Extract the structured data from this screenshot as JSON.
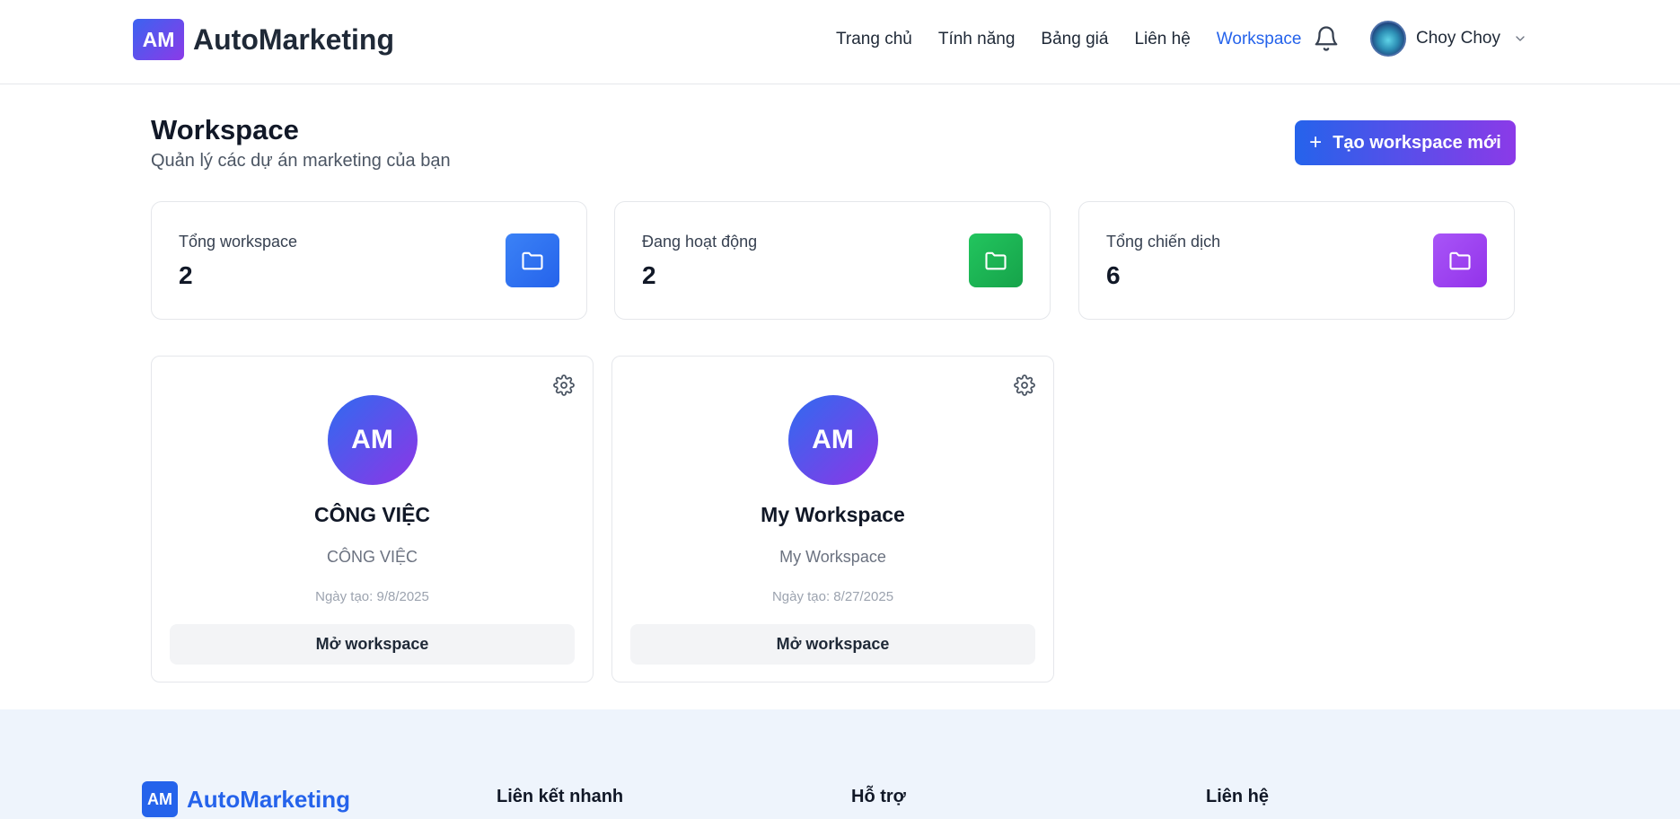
{
  "header": {
    "logo_text": "AM",
    "brand": "AutoMarketing",
    "nav": [
      "Trang chủ",
      "Tính năng",
      "Bảng giá",
      "Liên hệ",
      "Workspace"
    ],
    "active_nav": "Workspace",
    "user_name": "Choy Choy"
  },
  "page": {
    "title": "Workspace",
    "subtitle": "Quản lý các dự án marketing của bạn",
    "create_button": "Tạo workspace mới"
  },
  "stats": [
    {
      "label": "Tổng workspace",
      "value": "2",
      "icon": "folder-icon",
      "color": "#2f6bf0"
    },
    {
      "label": "Đang hoạt động",
      "value": "2",
      "icon": "folder-icon",
      "color": "#1fb254"
    },
    {
      "label": "Tổng chiến dịch",
      "value": "6",
      "icon": "folder-icon",
      "color": "#9b3ae8"
    }
  ],
  "workspaces": [
    {
      "avatar": "AM",
      "name": "CÔNG VIỆC",
      "description": "CÔNG VIỆC",
      "created": "Ngày tạo: 9/8/2025",
      "open_label": "Mở workspace"
    },
    {
      "avatar": "AM",
      "name": "My Workspace",
      "description": "My Workspace",
      "created": "Ngày tạo: 8/27/2025",
      "open_label": "Mở workspace"
    }
  ],
  "footer": {
    "logo_text": "AM",
    "brand": "AutoMarketing",
    "columns": [
      "Liên kết nhanh",
      "Hỗ trợ",
      "Liên hệ"
    ]
  },
  "colors": {
    "accent": "#2563eb",
    "gradient_end": "#8b3ae8",
    "footer_bg": "#eef4fc"
  }
}
